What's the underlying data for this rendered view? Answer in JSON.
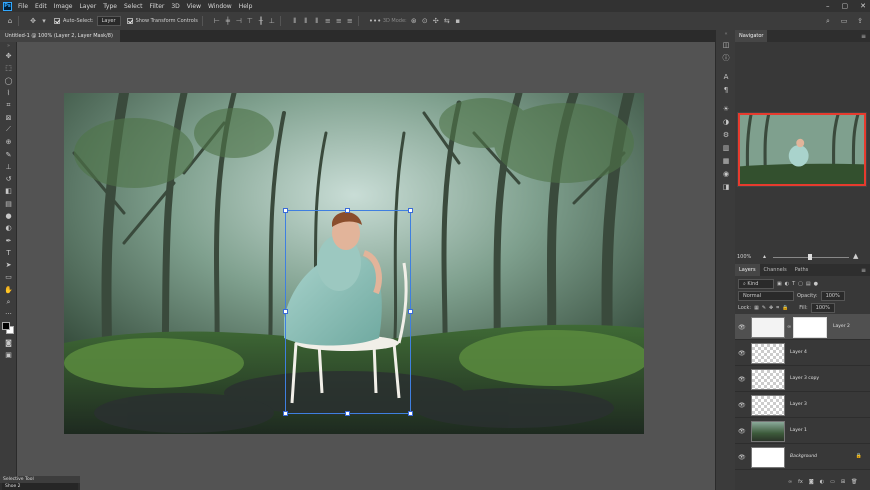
{
  "menubar": {
    "logo": "Ps",
    "items": [
      "File",
      "Edit",
      "Image",
      "Layer",
      "Type",
      "Select",
      "Filter",
      "3D",
      "View",
      "Window",
      "Help"
    ],
    "window_controls": [
      "–",
      "▢",
      "✕"
    ]
  },
  "options": {
    "auto_select_label": "Auto-Select:",
    "auto_select_value": "Layer",
    "show_transform_label": "Show Transform Controls",
    "three_d_label": "3D Mode:"
  },
  "document": {
    "tab_title": "Untitled-1 @ 100% (Layer 2, Layer Mask/8) *",
    "close": "×"
  },
  "panels": {
    "navigator_title": "Navigator",
    "zoom_value": "100%",
    "tabs": [
      "Layers",
      "Channels",
      "Paths"
    ],
    "filter_kind": "Kind",
    "blend_mode": "Normal",
    "opacity_label": "Opacity:",
    "opacity_value": "100%",
    "lock_label": "Lock:",
    "fill_label": "Fill:",
    "fill_value": "100%",
    "layers": [
      {
        "name": "Layer 2",
        "selected": true,
        "mask": true
      },
      {
        "name": "Layer 4",
        "selected": false,
        "mask": false
      },
      {
        "name": "Layer 3 copy",
        "selected": false,
        "mask": false
      },
      {
        "name": "Layer 3",
        "selected": false,
        "mask": false
      },
      {
        "name": "Layer 1",
        "selected": false,
        "mask": false
      },
      {
        "name": "Background",
        "selected": false,
        "mask": false
      }
    ]
  },
  "bottom_panel": {
    "title": "Selective Tool",
    "item": "Shoe 2"
  },
  "colors": {
    "accent_red": "#e63b2e",
    "transform_blue": "#3f7fe0"
  }
}
